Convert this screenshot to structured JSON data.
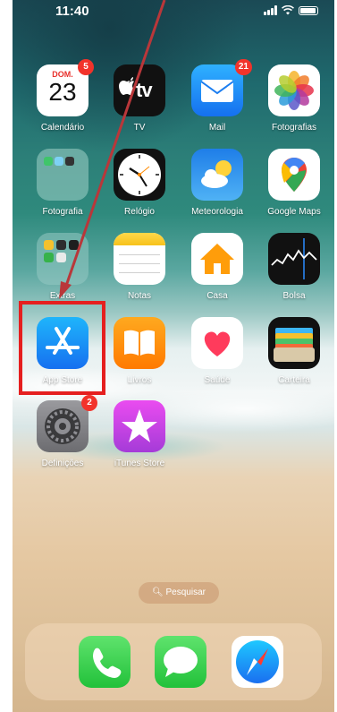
{
  "status_bar": {
    "time": "11:40"
  },
  "apps": [
    {
      "id": "calendario",
      "label": "Calendário",
      "badge": "5",
      "day_name": "DOM.",
      "day_number": "23"
    },
    {
      "id": "tv",
      "label": "TV",
      "glyph": "tv"
    },
    {
      "id": "mail",
      "label": "Mail",
      "badge": "21"
    },
    {
      "id": "fotografias",
      "label": "Fotografias"
    },
    {
      "id": "fotografia",
      "label": "Fotografia"
    },
    {
      "id": "relogio",
      "label": "Relógio"
    },
    {
      "id": "meteorologia",
      "label": "Meteorologia"
    },
    {
      "id": "google-maps",
      "label": "Google Maps"
    },
    {
      "id": "extras",
      "label": "Extras"
    },
    {
      "id": "notas",
      "label": "Notas"
    },
    {
      "id": "casa",
      "label": "Casa"
    },
    {
      "id": "bolsa",
      "label": "Bolsa"
    },
    {
      "id": "app-store",
      "label": "App Store"
    },
    {
      "id": "livros",
      "label": "Livros"
    },
    {
      "id": "saude",
      "label": "Saúde"
    },
    {
      "id": "carteira",
      "label": "Carteira"
    },
    {
      "id": "definicoes",
      "label": "Definições",
      "badge": "2"
    },
    {
      "id": "itunes-store",
      "label": "iTunes Store"
    }
  ],
  "search": {
    "label": "Pesquisar"
  },
  "dock": [
    {
      "id": "phone",
      "icon": "phone-icon"
    },
    {
      "id": "messages",
      "icon": "messages-icon"
    },
    {
      "id": "safari",
      "icon": "safari-icon"
    }
  ],
  "colors": {
    "highlight": "#e51f1f",
    "arrow": "#b9373a",
    "badge": "#f2332b"
  }
}
